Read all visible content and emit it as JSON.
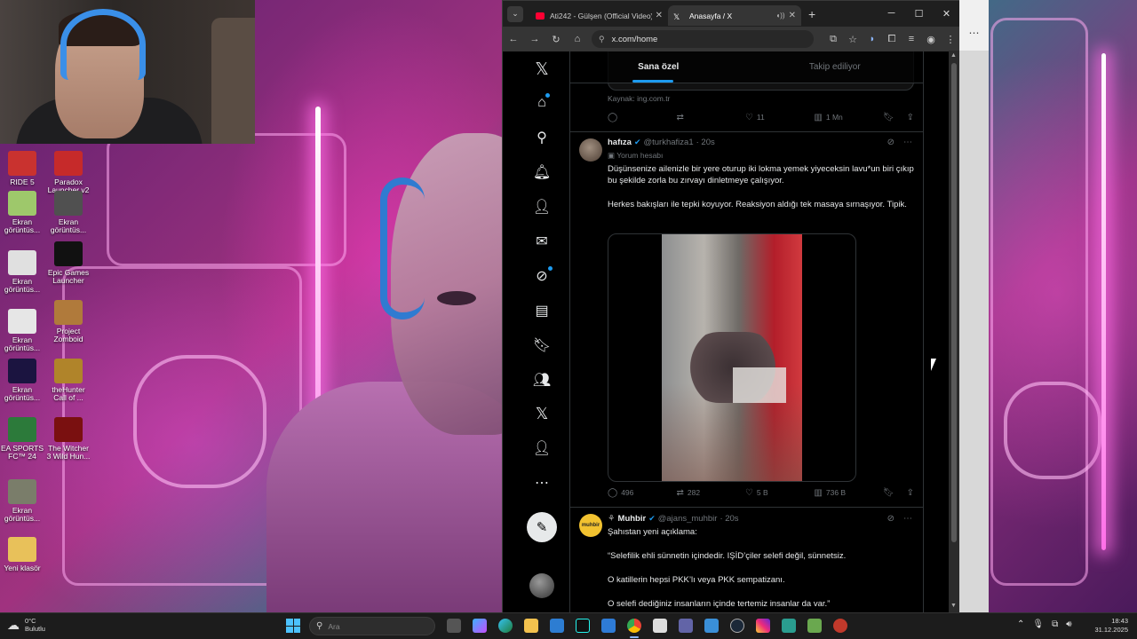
{
  "desktop": {
    "icons": [
      {
        "label": "RIDE 5",
        "color": "#c9322f"
      },
      {
        "label": "Paradox Launcher v2",
        "color": "#c62a2a"
      },
      {
        "label": "Ekran görüntüs...",
        "color": "#9ec86b"
      },
      {
        "label": "Ekran görüntüs...",
        "color": "#505050"
      },
      {
        "label": "Ekran görüntüs...",
        "color": "#e0e0e0"
      },
      {
        "label": "Epic Games Launcher",
        "color": "#111111"
      },
      {
        "label": "Ekran görüntüs...",
        "color": "#e6e6e6"
      },
      {
        "label": "Project Zomboid",
        "color": "#b07a3b"
      },
      {
        "label": "Ekran görüntüs...",
        "color": "#1b1440"
      },
      {
        "label": "theHunter Call of ...",
        "color": "#b0842a"
      },
      {
        "label": "EA SPORTS FC™ 24",
        "color": "#2c7a3a"
      },
      {
        "label": "The Witcher 3 Wild Hun...",
        "color": "#7a1010"
      },
      {
        "label": "Ekran görüntüs...",
        "color": "#7a7d6a"
      },
      {
        "label": "Yeni klasör",
        "color": "#e8c15a"
      }
    ]
  },
  "browser": {
    "tabs": [
      {
        "title": "Ati242 - Gülşen (Official Video)",
        "favicon_color": "#ff0033"
      },
      {
        "title": "Anasayfa / X",
        "favicon_color": "#ffffff"
      }
    ],
    "new_tab": "+",
    "window_controls": {
      "minimize": "─",
      "maximize": "☐",
      "close": "✕"
    },
    "url": "x.com/home"
  },
  "x": {
    "feed_tabs": {
      "for_you": "Sana özel",
      "following": "Takip ediliyor"
    },
    "previous_post": {
      "source": "Kaynak: ing.com.tr",
      "replies": "",
      "reposts": "",
      "likes": "11",
      "views": "1 Mn"
    },
    "tweets": [
      {
        "name": "hafıza",
        "handle": "@turkhafiza1",
        "time": "· 20s",
        "badge": "Yorum hesabı",
        "avatar_color": "#6e5a4a",
        "text1": "Düşünsenize ailenizle bir yere oturup iki lokma yemek yiyeceksin lavu*un biri çıkıp bu şekilde zorla bu zırvayı dinletmeye çalışıyor.",
        "text2": "Herkes bakışları ile tepki koyuyor. Reaksiyon aldığı tek masaya sırnaşıyor. Tipik.",
        "replies": "496",
        "reposts": "282",
        "likes": "5 B",
        "views": "736 B"
      },
      {
        "name": "Muhbir",
        "handle": "@ajans_muhbir",
        "time": "· 20s",
        "avatar_color": "#f2c230",
        "avatar_text": "muhbir",
        "line1": "Şahıstan yeni açıklama:",
        "line2": "“Selefilik ehli sünnetin içindedir. IŞİD’çiler selefi değil, sünnetsiz.",
        "line3": "O katillerin hepsi PKK’lı veya PKK sempatizanı.",
        "line4": "O selefi dediğiniz insanların içinde tertemiz insanlar da var.”"
      }
    ]
  },
  "taskbar": {
    "weather_temp": "0°C",
    "weather_desc": "Bulutlu",
    "search_placeholder": "Ara",
    "time": "18:43",
    "date": "31.12.2025"
  }
}
